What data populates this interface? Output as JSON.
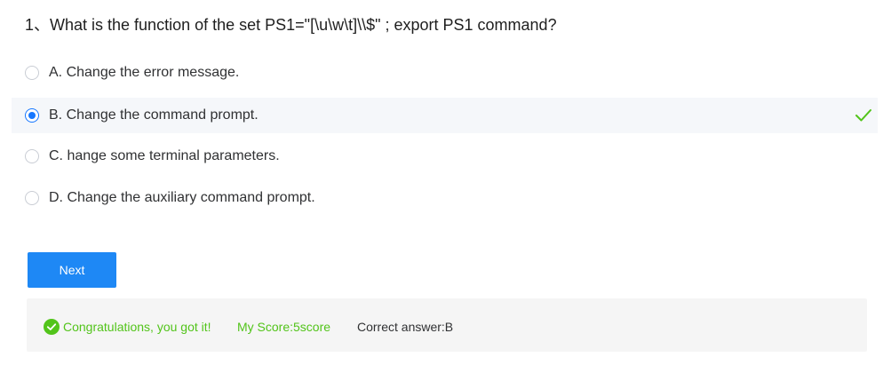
{
  "question": {
    "text": "1、What is the function of the set PS1=\"[\\u\\w\\t]\\\\$\" ; export PS1 command?"
  },
  "options": [
    {
      "label": "A. Change the error message.",
      "selected": false
    },
    {
      "label": "B. Change the command prompt.",
      "selected": true,
      "icon": "check-icon"
    },
    {
      "label": "C. hange some terminal parameters.",
      "selected": false
    },
    {
      "label": "D. Change the auxiliary command prompt.",
      "selected": false
    }
  ],
  "next_button": {
    "label": "Next"
  },
  "result": {
    "icon": "check-circle-icon",
    "congrats": "Congratulations, you got it!",
    "score": "My Score:5score",
    "correct_answer": "Correct answer:B"
  },
  "colors": {
    "accent": "#1677ff",
    "success": "#52c41a",
    "button": "#1e88f5",
    "selected_bg": "#f5f7fa",
    "result_bg": "#f5f5f5"
  }
}
